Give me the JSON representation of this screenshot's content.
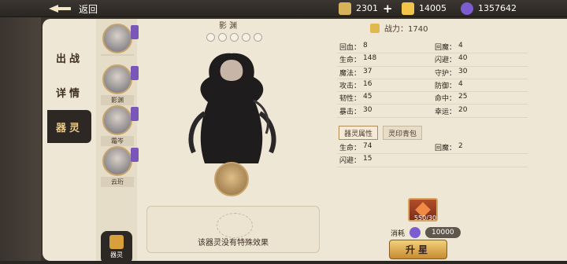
{
  "topbar": {
    "back_label": "返回",
    "resources": [
      {
        "name": "scroll-resource",
        "value": "2301",
        "icon": "scroll-icon",
        "color": "#d7b25b"
      },
      {
        "name": "gold-resource",
        "value": "14005",
        "icon": "gold-ingot-icon",
        "color": "#f2c44a"
      },
      {
        "name": "gem-resource",
        "value": "1357642",
        "icon": "purple-gem-icon",
        "color": "#7d5ccf"
      }
    ]
  },
  "tabs": [
    "出战",
    "详情",
    "器灵"
  ],
  "active_tab": 2,
  "characters": [
    {
      "label": "",
      "icon": "char-avatar-1"
    },
    {
      "label": "影渊",
      "icon": "char-avatar-2"
    },
    {
      "label": "霜岑",
      "icon": "char-avatar-3"
    },
    {
      "label": "云珩",
      "icon": "char-avatar-4"
    }
  ],
  "slot_button_label": "器灵",
  "spirit": {
    "name": "影渊",
    "stars": 5,
    "effect_text": "该器灵没有特殊效果"
  },
  "power": {
    "label": "战力：1740"
  },
  "stats": [
    {
      "k1": "回血：",
      "v1": "8",
      "k2": "回魔：",
      "v2": "4"
    },
    {
      "k1": "生命：",
      "v1": "148",
      "k2": "闪避：",
      "v2": "40"
    },
    {
      "k1": "魔法：",
      "v1": "37",
      "k2": "守护：",
      "v2": "30"
    },
    {
      "k1": "攻击：",
      "v1": "16",
      "k2": "防御：",
      "v2": "4"
    },
    {
      "k1": "韧性：",
      "v1": "45",
      "k2": "命中：",
      "v2": "25"
    },
    {
      "k1": "暴击：",
      "v1": "30",
      "k2": "幸运：",
      "v2": "20"
    }
  ],
  "subtabs": [
    "器灵属性",
    "灵印青包"
  ],
  "active_subtab": 0,
  "substats": [
    {
      "k1": "生命：",
      "v1": "74",
      "k2": "回魔：",
      "v2": "2"
    },
    {
      "k1": "闪避：",
      "v1": "15",
      "k2": "",
      "v2": ""
    }
  ],
  "upgrade_card": {
    "count": "550/30"
  },
  "cost": {
    "label": "消耗",
    "value": "10000"
  },
  "upgrade_button": "升星"
}
